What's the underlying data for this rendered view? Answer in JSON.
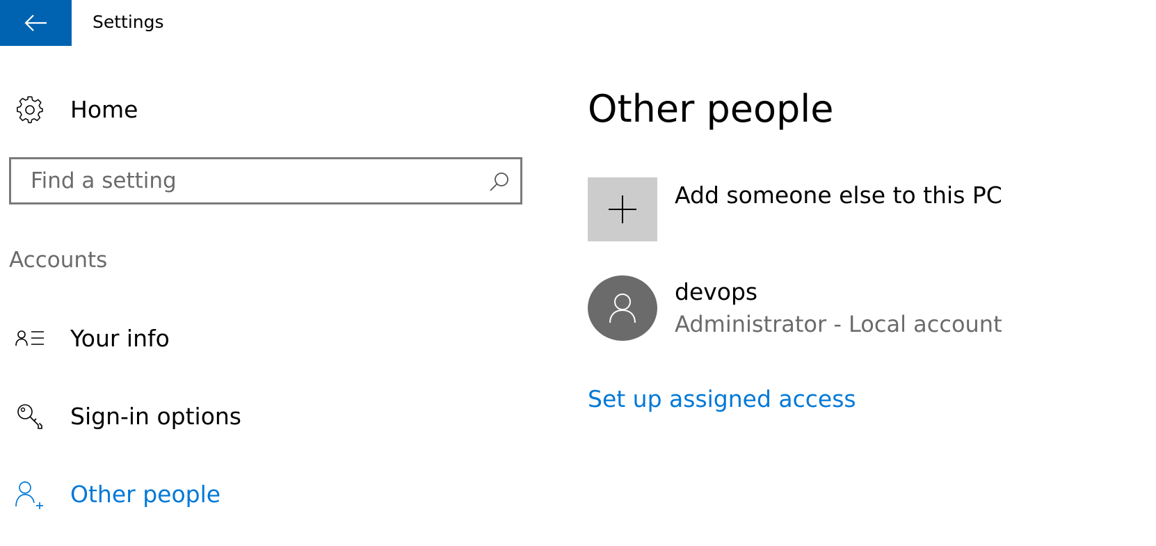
{
  "window": {
    "title": "Settings"
  },
  "sidebar": {
    "home_label": "Home",
    "search": {
      "placeholder": "Find a setting",
      "value": ""
    },
    "section_title": "Accounts",
    "items": [
      {
        "label": "Your info",
        "icon": "contact-card-icon",
        "active": false
      },
      {
        "label": "Sign-in options",
        "icon": "key-icon",
        "active": false
      },
      {
        "label": "Other people",
        "icon": "add-person-icon",
        "active": true
      }
    ]
  },
  "main": {
    "title": "Other people",
    "add_person_label": "Add someone else to this PC",
    "users": [
      {
        "name": "devops",
        "role": "Administrator - Local account"
      }
    ],
    "assigned_access_link": "Set up assigned access"
  },
  "colors": {
    "accent": "#0078d7",
    "back_button": "#0063b1",
    "tile_gray": "#cccccc",
    "avatar_gray": "#6b6b6b",
    "secondary_text": "#6b6b6b"
  }
}
